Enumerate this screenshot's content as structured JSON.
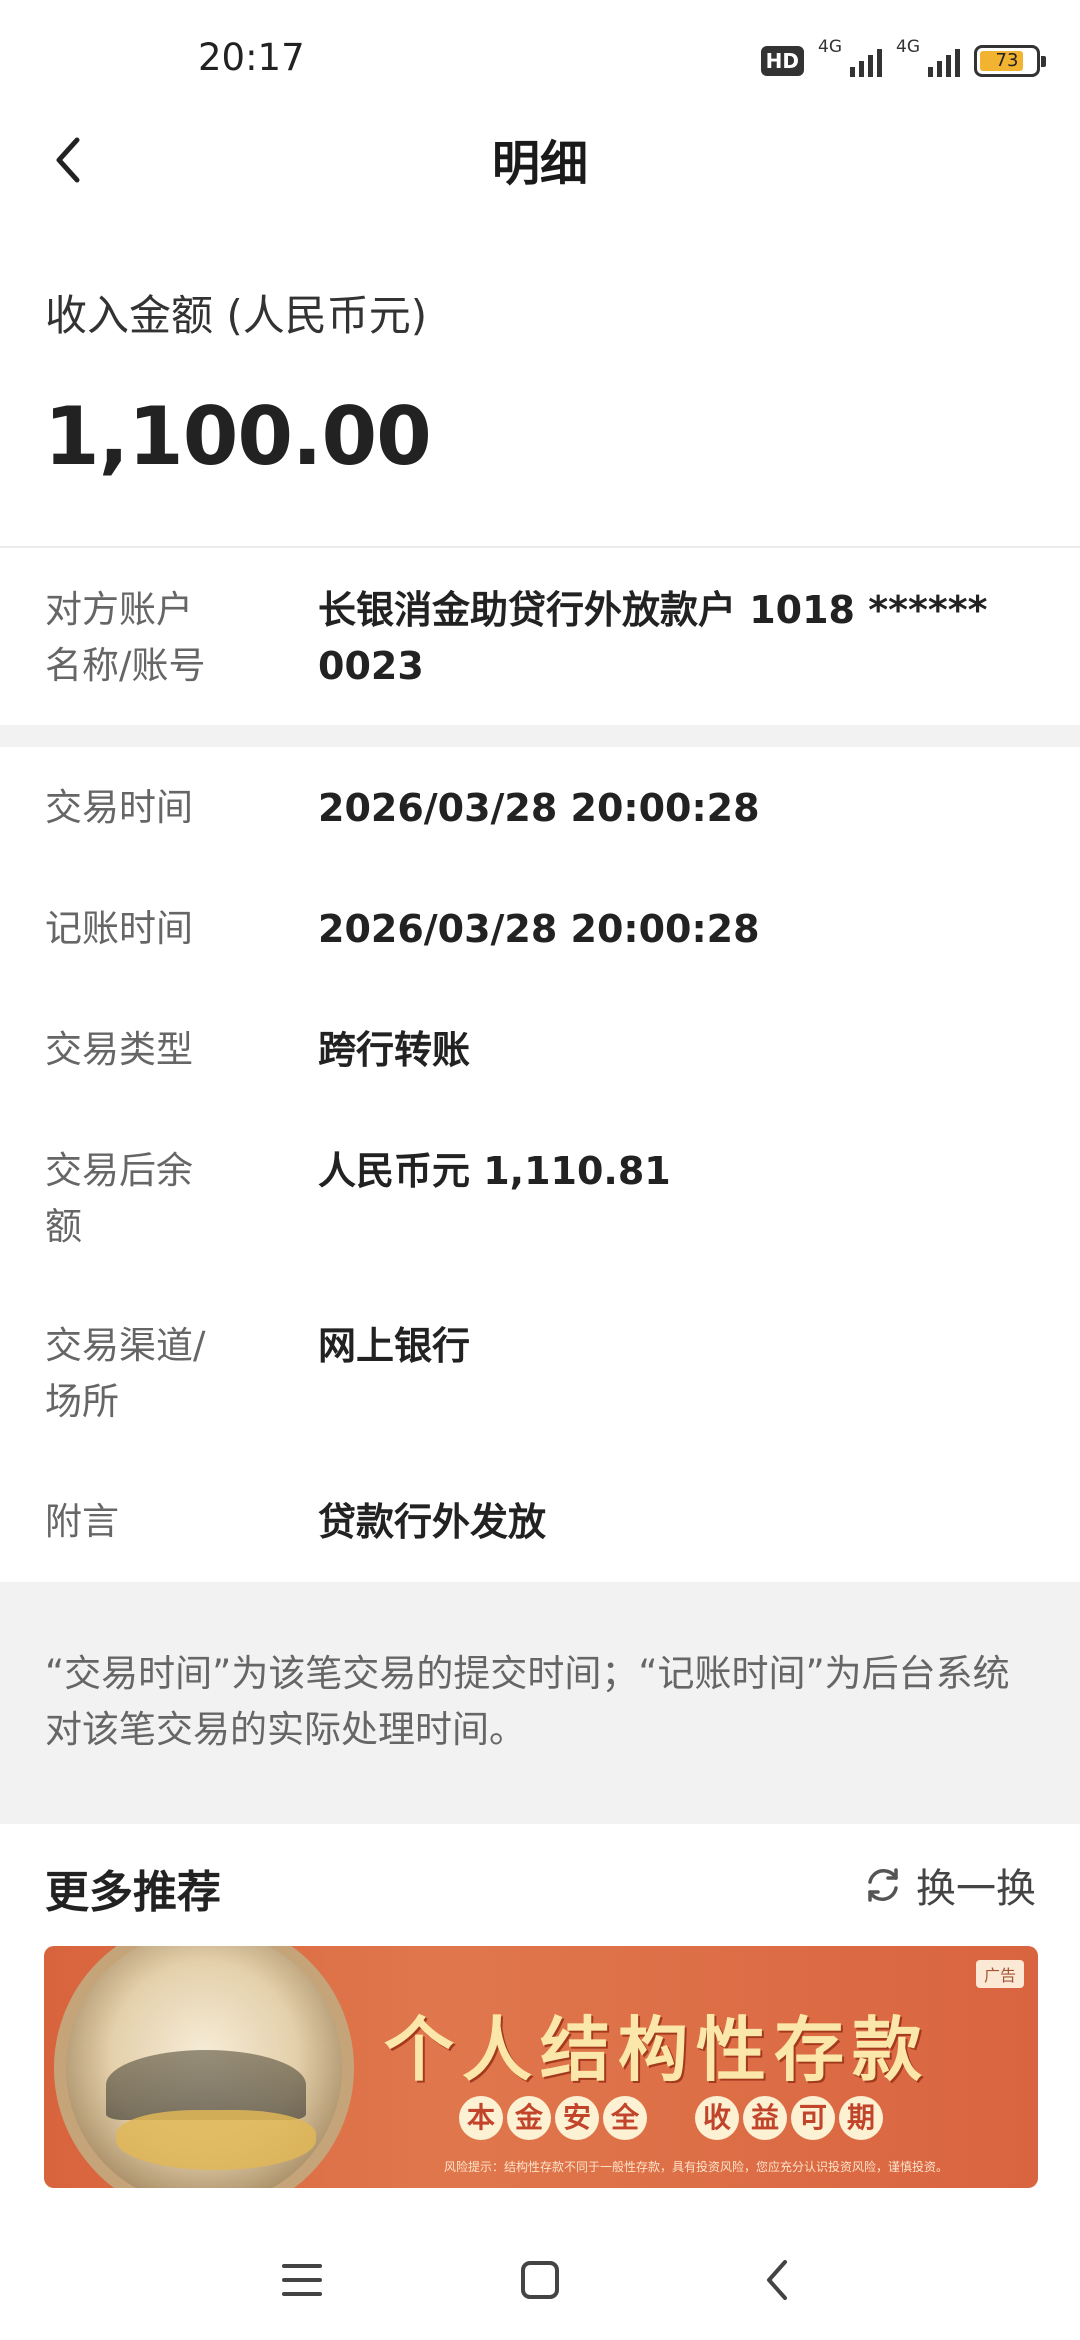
{
  "status_bar": {
    "time": "20:17",
    "hd_badge": "HD",
    "network_1": "4G",
    "network_2": "4G",
    "battery_level": "73"
  },
  "header": {
    "title": "明细",
    "back_icon": "chevron-left-icon"
  },
  "amount": {
    "label": "收入金额 (人民币元)",
    "value": "1,100.00"
  },
  "counterparty": {
    "label_line1": "对方账户",
    "label_line2": "名称/账号",
    "value": "长银消金助贷行外放款户 1018 ****** 0023"
  },
  "details": [
    {
      "label": "交易时间",
      "value": "2026/03/28 20:00:28"
    },
    {
      "label": "记账时间",
      "value": "2026/03/28 20:00:28"
    },
    {
      "label": "交易类型",
      "value": "跨行转账"
    },
    {
      "label_line1": "交易后余",
      "label_line2": "额",
      "value": "人民币元 1,110.81"
    },
    {
      "label_line1": "交易渠道/",
      "label_line2": "场所",
      "value": "网上银行"
    },
    {
      "label": "附言",
      "value": "贷款行外发放"
    }
  ],
  "note": "“交易时间”为该笔交易的提交时间；“记账时间”为后台系统对该笔交易的实际处理时间。",
  "recommend": {
    "title": "更多推荐",
    "refresh_label": "换一换",
    "banner": {
      "ad_badge": "广告",
      "headline": "个人结构性存款",
      "tag1": [
        "本",
        "金",
        "安",
        "全"
      ],
      "tag2": [
        "收",
        "益",
        "可",
        "期"
      ],
      "risk": "风险提示：结构性存款不同于一般性存款，具有投资风险，您应充分认识投资风险，谨慎投资。"
    }
  },
  "colors": {
    "accent": "#d8643d",
    "gap_bg": "#f2f2f2",
    "label_text": "#666666"
  }
}
